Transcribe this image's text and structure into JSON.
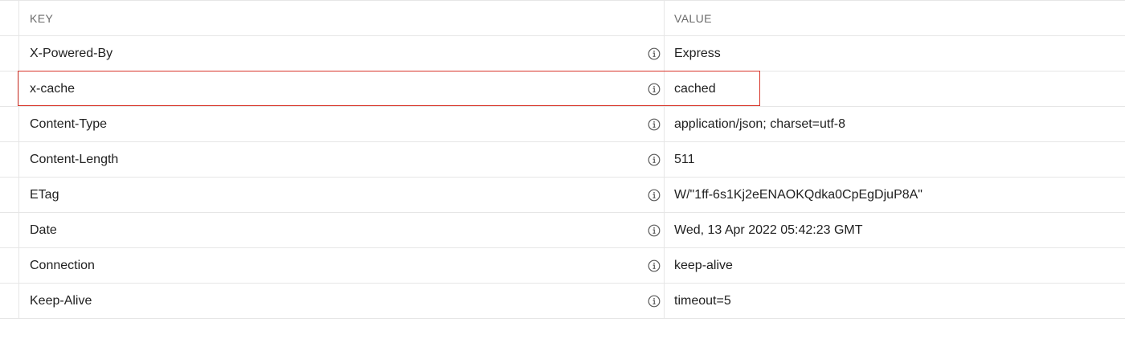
{
  "header": {
    "key_label": "KEY",
    "value_label": "VALUE"
  },
  "rows": [
    {
      "key": "X-Powered-By",
      "value": "Express"
    },
    {
      "key": "x-cache",
      "value": "cached"
    },
    {
      "key": "Content-Type",
      "value": "application/json; charset=utf-8"
    },
    {
      "key": "Content-Length",
      "value": "511"
    },
    {
      "key": "ETag",
      "value": "W/\"1ff-6s1Kj2eENAOKQdka0CpEgDjuP8A\""
    },
    {
      "key": "Date",
      "value": "Wed, 13 Apr 2022 05:42:23 GMT"
    },
    {
      "key": "Connection",
      "value": "keep-alive"
    },
    {
      "key": "Keep-Alive",
      "value": "timeout=5"
    }
  ],
  "icons": {
    "row_info": "info-icon"
  },
  "colors": {
    "highlight_border": "#d8352a",
    "grid_line": "#e6e6e6",
    "header_text": "#6b6b6b"
  }
}
